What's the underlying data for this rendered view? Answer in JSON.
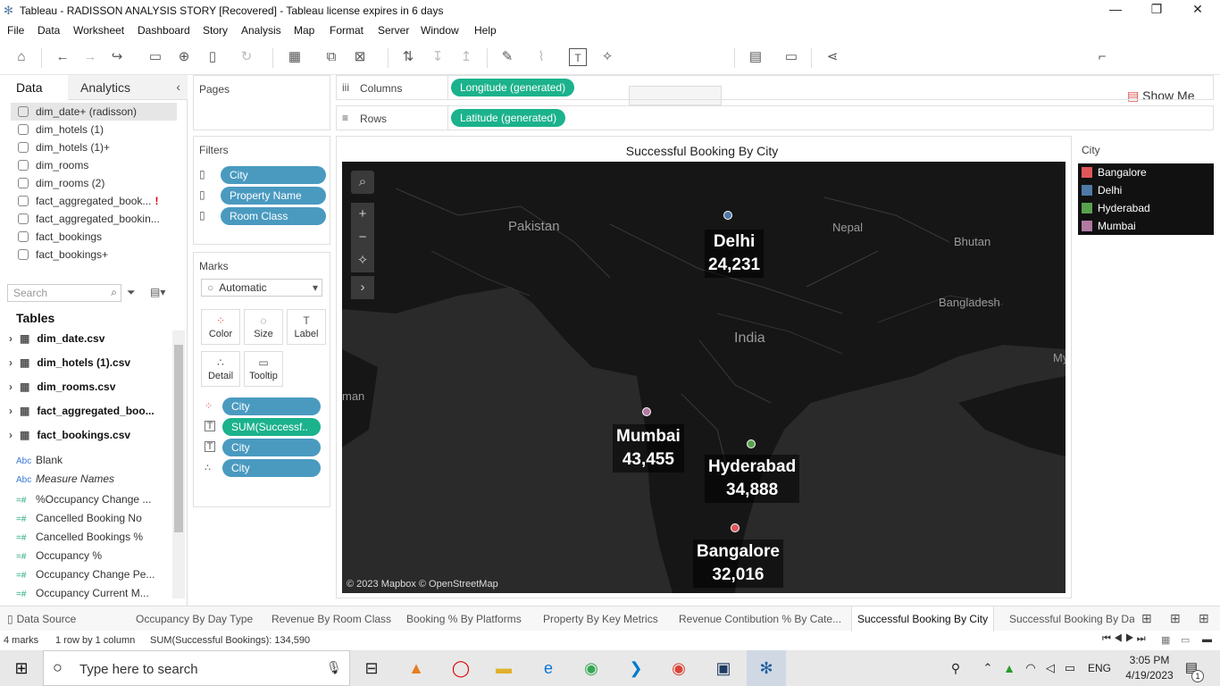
{
  "window": {
    "title": "Tableau - RADISSON ANALYSIS STORY [Recovered] - Tableau license expires in 6 days"
  },
  "menu": [
    "File",
    "Data",
    "Worksheet",
    "Dashboard",
    "Story",
    "Analysis",
    "Map",
    "Format",
    "Server",
    "Window",
    "Help"
  ],
  "toolbar": {
    "show_me": "Show Me"
  },
  "sidebar": {
    "tab_data": "Data",
    "tab_analytics": "Analytics",
    "datasources": [
      "dim_date+ (radisson)",
      "dim_hotels (1)",
      "dim_hotels (1)+",
      "dim_rooms",
      "dim_rooms (2)",
      "fact_aggregated_book...",
      "fact_aggregated_bookin...",
      "fact_bookings",
      "fact_bookings+"
    ],
    "search_placeholder": "Search",
    "tables_heading": "Tables",
    "tables": [
      "dim_date.csv",
      "dim_hotels (1).csv",
      "dim_rooms.csv",
      "fact_aggregated_boo...",
      "fact_bookings.csv"
    ],
    "fields": [
      {
        "type": "Abc",
        "name": "Blank"
      },
      {
        "type": "Abc",
        "name": "Measure Names"
      },
      {
        "type": "=#",
        "name": "%Occupancy Change ..."
      },
      {
        "type": "=#",
        "name": "Cancelled Booking No"
      },
      {
        "type": "=#",
        "name": "Cancelled Bookings %"
      },
      {
        "type": "=#",
        "name": "Occupancy %"
      },
      {
        "type": "=#",
        "name": "Occupancy Change Pe..."
      },
      {
        "type": "=#",
        "name": "Occupancy Current M..."
      }
    ]
  },
  "pages": {
    "title": "Pages"
  },
  "filters": {
    "title": "Filters",
    "items": [
      "City",
      "Property Name",
      "Room Class"
    ]
  },
  "marks": {
    "title": "Marks",
    "type": "Automatic",
    "buttons": [
      "Color",
      "Size",
      "Label",
      "Detail",
      "Tooltip"
    ],
    "pills": [
      "City",
      "SUM(Successf..",
      "City",
      "City"
    ]
  },
  "shelves": {
    "columns_label": "Columns",
    "columns_pill": "Longitude (generated)",
    "rows_label": "Rows",
    "rows_pill": "Latitude (generated)"
  },
  "viz": {
    "title": "Successful Booking By City",
    "attribution": "© 2023 Mapbox © OpenStreetMap",
    "map_labels": [
      "Pakistan",
      "Nepal",
      "Bhutan",
      "Bangladesh",
      "India",
      "man",
      "My"
    ]
  },
  "chart_data": {
    "type": "map",
    "title": "Successful Booking By City",
    "points": [
      {
        "city": "Delhi",
        "value": "24,231",
        "color": "#4e79a7"
      },
      {
        "city": "Mumbai",
        "value": "43,455",
        "color": "#b07aa1"
      },
      {
        "city": "Hyderabad",
        "value": "34,888",
        "color": "#59a14f"
      },
      {
        "city": "Bangalore",
        "value": "32,016",
        "color": "#e15759"
      }
    ]
  },
  "legend": {
    "title": "City",
    "items": [
      {
        "name": "Bangalore",
        "color": "#e15759"
      },
      {
        "name": "Delhi",
        "color": "#4e79a7"
      },
      {
        "name": "Hyderabad",
        "color": "#59a14f"
      },
      {
        "name": "Mumbai",
        "color": "#b07aa1"
      }
    ]
  },
  "sheet_tabs": [
    "Data Source",
    "Occupancy By Day Type",
    "Revenue By Room Class",
    "Booking % By Platforms",
    "Property By Key Metrics",
    "Revenue Contibution % By Cate...",
    "Successful Booking By City",
    "Successful Booking By Da"
  ],
  "status": {
    "marks": "4 marks",
    "rows": "1 row by 1 column",
    "sum": "SUM(Successful Bookings): 134,590"
  },
  "taskbar": {
    "search_placeholder": "Type here to search",
    "lang": "ENG",
    "time": "3:05 PM",
    "date": "4/19/2023",
    "notif": "1"
  }
}
